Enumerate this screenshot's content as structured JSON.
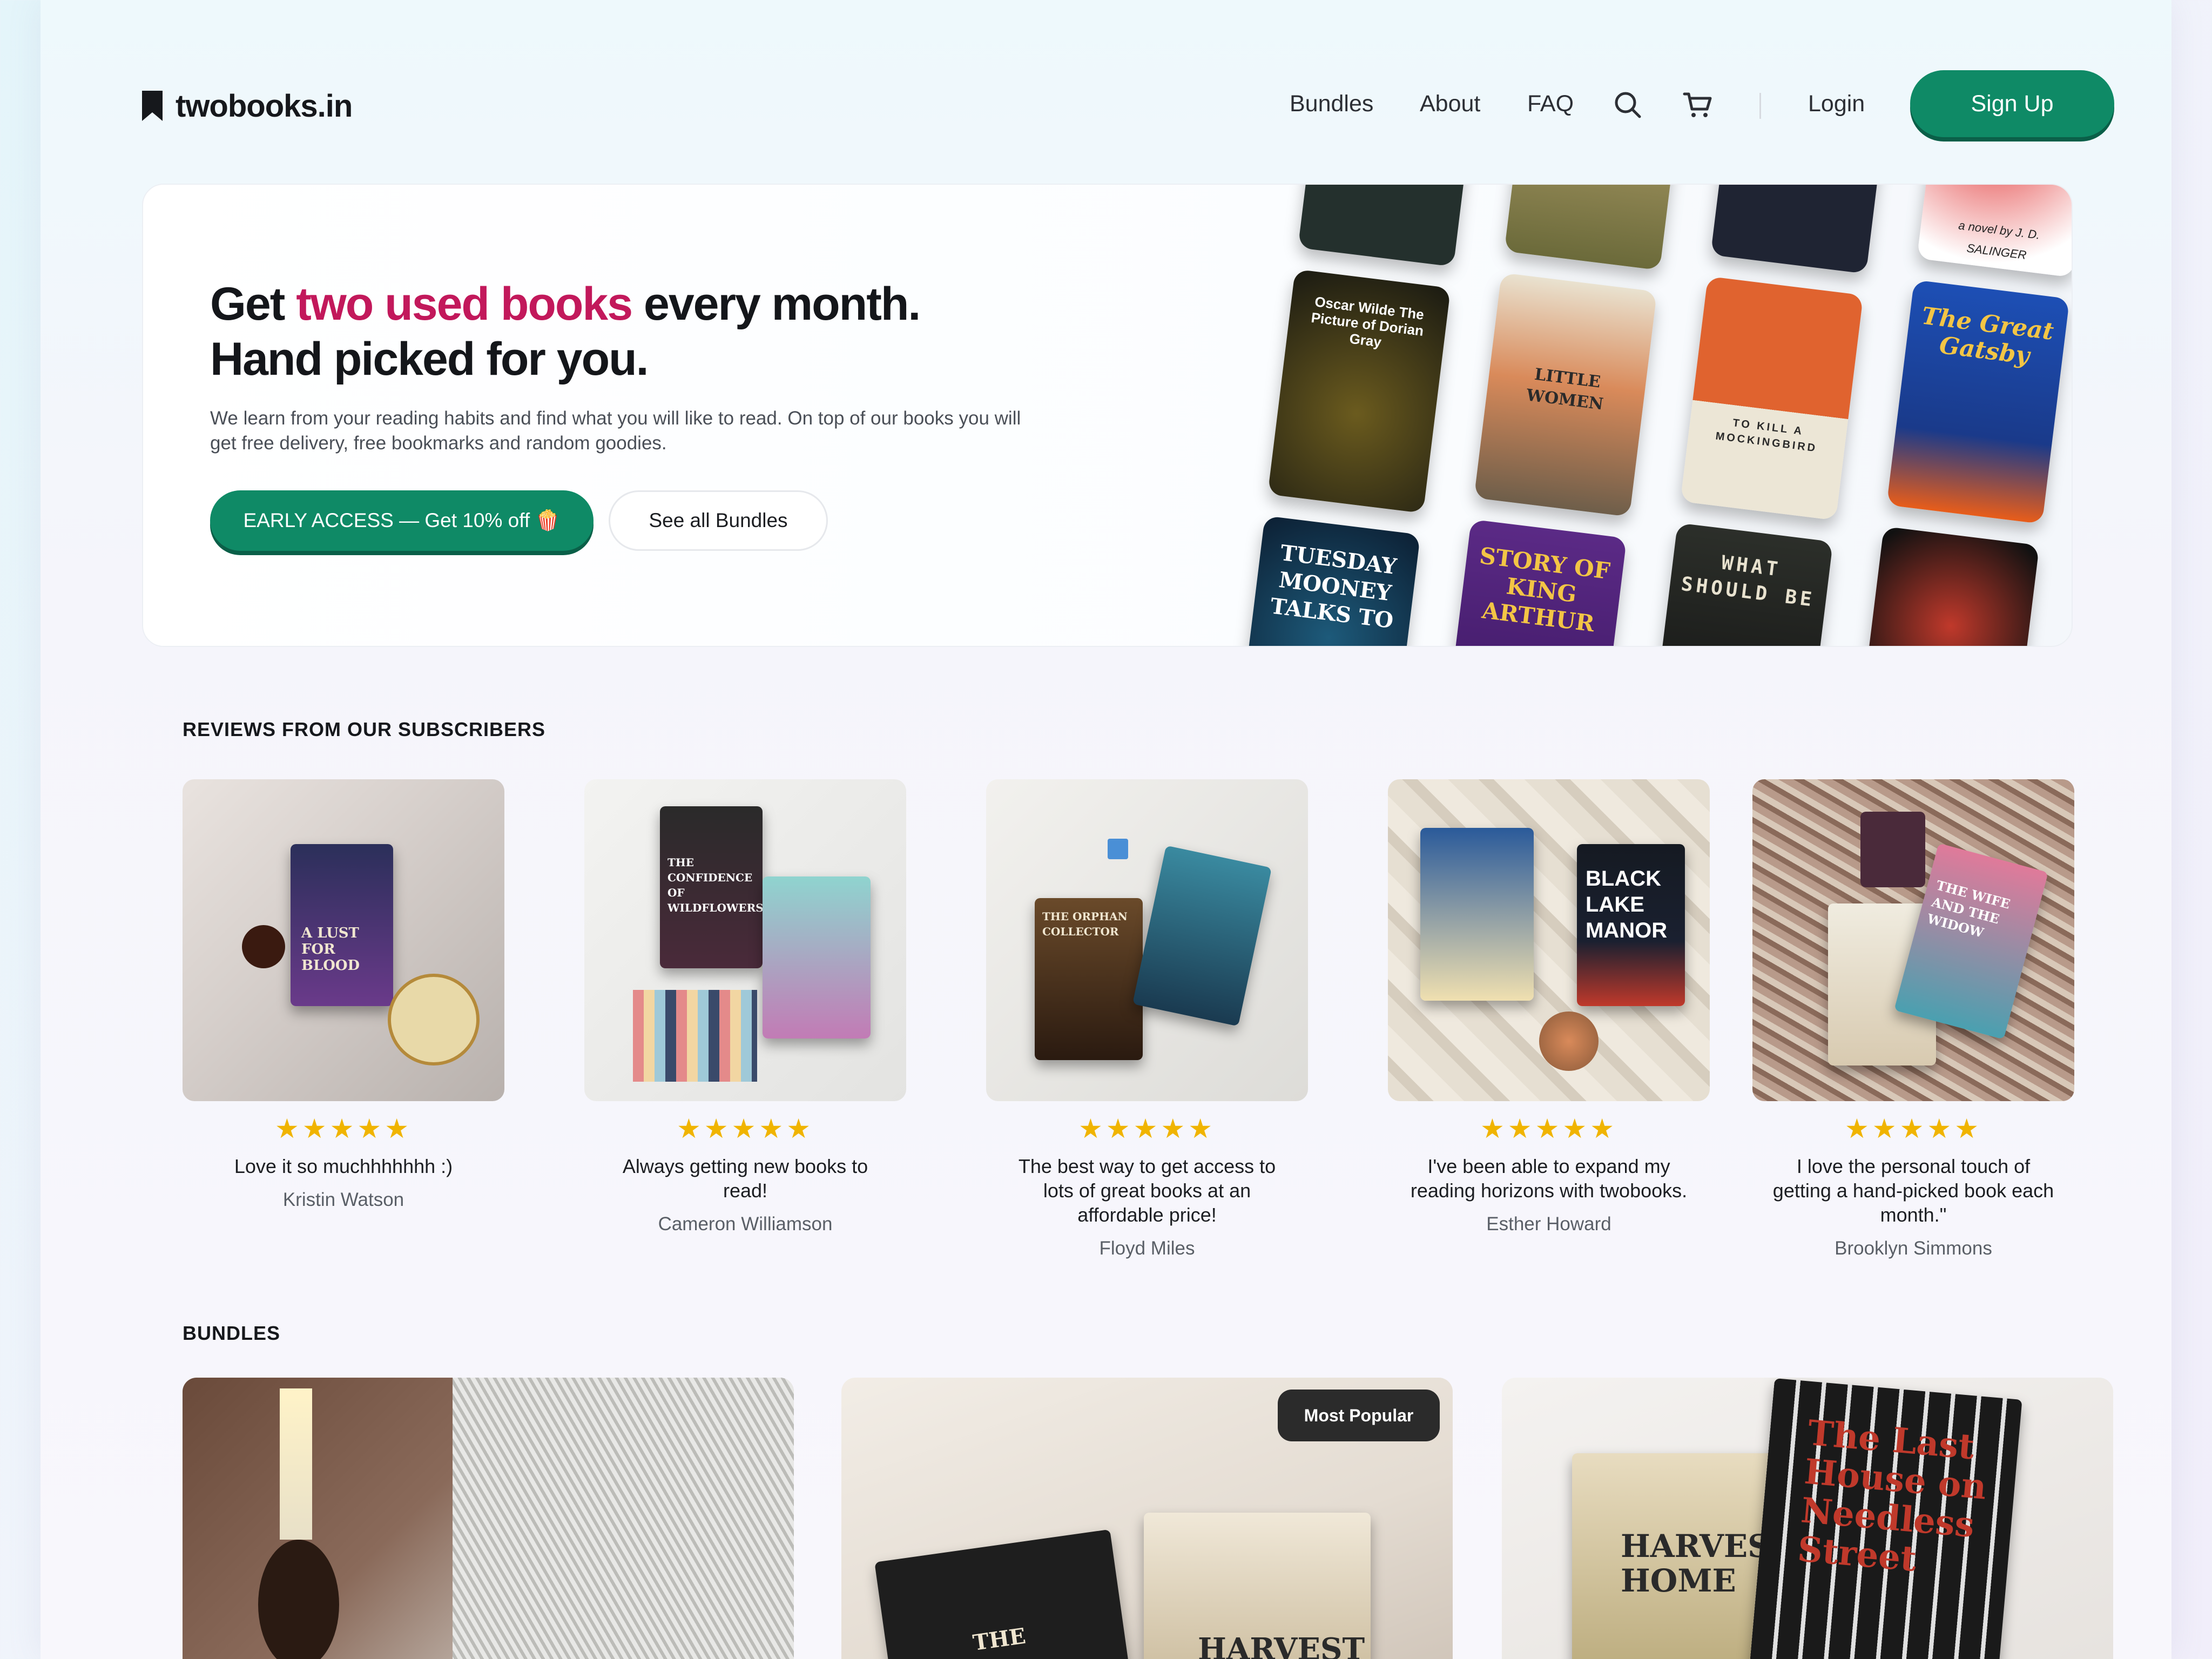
{
  "brand": {
    "name": "twobooks.in"
  },
  "nav": {
    "links": [
      "Bundles",
      "About",
      "FAQ"
    ],
    "login": "Login",
    "signup": "Sign Up"
  },
  "hero": {
    "headline_pre": "Get ",
    "headline_accent": "two used books",
    "headline_post": " every month.",
    "headline_line2": "Hand picked for you.",
    "subtext": "We learn from your reading habits and find what you will like to read. On top of our books you will get free delivery, free bookmarks and random goodies.",
    "cta_primary": "EARLY ACCESS — Get 10% off 🍿",
    "cta_secondary": "See all Bundles",
    "covers": [
      "Oscar Wilde The Picture of Dorian Gray",
      "LITTLE WOMEN",
      "TO KILL A MOCKINGBIRD",
      "The Great Gatsby",
      "TUESDAY MOONEY TALKS TO",
      "STORY OF KING ARTHUR",
      "WHAT SHOULD BE",
      "a novel by J. D. SALINGER"
    ]
  },
  "reviews": {
    "title": "REVIEWS FROM OUR SUBSCRIBERS",
    "items": [
      {
        "stars": "★★★★★",
        "text": "Love it so muchhhhhhh :)",
        "name": "Kristin Watson",
        "cover": "A LUST FOR BLOOD"
      },
      {
        "stars": "★★★★★",
        "text": "Always getting new books to read!",
        "name": "Cameron Williamson",
        "cover": "THE CONFIDENCE OF WILDFLOWERS"
      },
      {
        "stars": "★★★★★",
        "text": "The best way to get access to lots of great books at an affordable price!",
        "name": "Floyd Miles",
        "cover": "THE ORPHAN COLLECTOR"
      },
      {
        "stars": "★★★★★",
        "text": "I've been able to expand my reading horizons with twobooks.",
        "name": "Esther Howard",
        "cover": "BLACK LAKE MANOR"
      },
      {
        "stars": "★★★★★",
        "text": "I love the personal touch of getting a hand-picked book each month.\"",
        "name": "Brooklyn Simmons",
        "cover": "THE WIFE AND THE WIDOW"
      }
    ]
  },
  "bundles": {
    "title": "BUNDLES",
    "badge": "Most Popular",
    "covers": [
      "THE",
      "HARVEST",
      "HARVEST HOME",
      "The Last House on Needless Street"
    ]
  },
  "colors": {
    "primary": "#0f8a66",
    "accent": "#c2185b",
    "star": "#f0b400"
  }
}
